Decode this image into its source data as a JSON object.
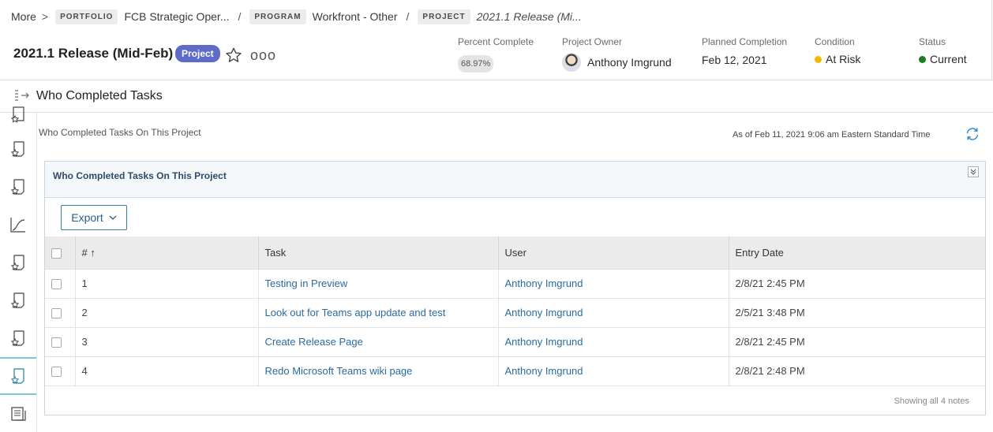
{
  "breadcrumb": {
    "more": "More",
    "portfolio_tag": "PORTFOLIO",
    "portfolio_name": "FCB Strategic Oper...",
    "program_tag": "PROGRAM",
    "program_name": "Workfront - Other",
    "project_tag": "PROJECT",
    "project_name": "2021.1 Release (Mi..."
  },
  "header": {
    "title": "2021.1 Release (Mid-Feb)",
    "badge": "Project",
    "more_icon": "ooo",
    "percent_complete": {
      "label": "Percent Complete",
      "value": "68.97%"
    },
    "project_owner": {
      "label": "Project Owner",
      "value": "Anthony Imgrund"
    },
    "planned_completion": {
      "label": "Planned Completion",
      "value": "Feb 12, 2021"
    },
    "condition": {
      "label": "Condition",
      "value": "At Risk",
      "color": "#f5b800"
    },
    "status": {
      "label": "Status",
      "value": "Current",
      "color": "#1a7f1a"
    }
  },
  "section": {
    "title": "Who Completed Tasks"
  },
  "rail": {
    "icons": [
      "report-icon",
      "report-icon",
      "report-icon",
      "chart-icon",
      "report-icon",
      "report-icon",
      "report-icon",
      "report-icon",
      "notes-icon"
    ],
    "active_index": 7
  },
  "content": {
    "title": "Who Completed Tasks On This Project",
    "asof": "As of  Feb 11, 2021 9:06 am Eastern Standard Time"
  },
  "panel": {
    "title": "Who Completed Tasks On This Project",
    "export_label": "Export",
    "columns": {
      "num": "# ↑",
      "task": "Task",
      "user": "User",
      "entry_date": "Entry Date"
    },
    "rows": [
      {
        "num": "1",
        "task": "Testing in Preview",
        "user": "Anthony Imgrund",
        "date": "2/8/21 2:45 PM"
      },
      {
        "num": "2",
        "task": "Look out for Teams app update and test",
        "user": "Anthony Imgrund",
        "date": "2/5/21 3:48 PM"
      },
      {
        "num": "3",
        "task": "Create Release Page",
        "user": "Anthony Imgrund",
        "date": "2/8/21 2:45 PM"
      },
      {
        "num": "4",
        "task": "Redo Microsoft Teams wiki page",
        "user": "Anthony Imgrund",
        "date": "2/8/21 2:48 PM"
      }
    ],
    "footer": "Showing all 4 notes"
  },
  "colors": {
    "accent": "#5e6bc8",
    "link": "#2a6aa0",
    "active_rail": "#7ac7db"
  }
}
